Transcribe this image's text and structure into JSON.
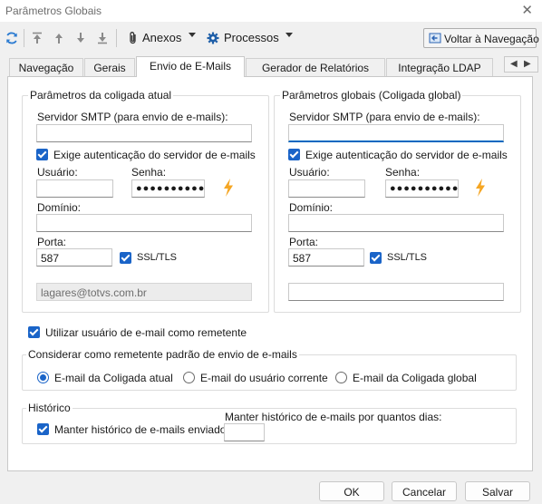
{
  "window": {
    "title": "Parâmetros Globais"
  },
  "toolbar": {
    "anexos_label": "Anexos",
    "processos_label": "Processos",
    "voltar_label": "Voltar à Navegação"
  },
  "tabs": [
    {
      "label": "Navegação"
    },
    {
      "label": "Gerais"
    },
    {
      "label": "Envio de E-Mails",
      "active": true
    },
    {
      "label": "Gerador de Relatórios"
    },
    {
      "label": "Integração LDAP"
    }
  ],
  "coligada_atual": {
    "legend": "Parâmetros da coligada atual",
    "smtp_label": "Servidor SMTP (para envio de e-mails):",
    "smtp_value": "",
    "auth_label": "Exige autenticação do servidor de e-mails",
    "auth_checked": true,
    "usuario_label": "Usuário:",
    "usuario_value": "",
    "senha_label": "Senha:",
    "senha_value": "●●●●●●●●●●●",
    "dominio_label": "Domínio:",
    "dominio_value": "",
    "porta_label": "Porta:",
    "porta_value": "587",
    "ssl_label": "SSL/TLS",
    "ssl_checked": true,
    "email_value": "lagares@totvs.com.br"
  },
  "coligada_global": {
    "legend": "Parâmetros globais (Coligada global)",
    "smtp_label": "Servidor SMTP (para envio de e-mails):",
    "smtp_value": "",
    "auth_label": "Exige autenticação do servidor de e-mails",
    "auth_checked": true,
    "usuario_label": "Usuário:",
    "usuario_value": "",
    "senha_label": "Senha:",
    "senha_value": "●●●●●●●●●●●",
    "dominio_label": "Domínio:",
    "dominio_value": "",
    "porta_label": "Porta:",
    "porta_value": "587",
    "ssl_label": "SSL/TLS",
    "ssl_checked": true,
    "email_value": ""
  },
  "utilizar_remetente_label": "Utilizar usuário de e-mail como remetente",
  "remetente_padrao": {
    "legend": "Considerar como remetente padrão de envio de e-mails",
    "options": [
      "E-mail da Coligada atual",
      "E-mail do usuário corrente",
      "E-mail da Coligada global"
    ],
    "selected": "E-mail da Coligada atual"
  },
  "historico": {
    "legend": "Histórico",
    "manter_label": "Manter histórico de e-mails enviados",
    "manter_checked": true,
    "dias_label": "Manter histórico de e-mails por quantos dias:",
    "dias_value": ""
  },
  "buttons": {
    "ok": "OK",
    "cancelar": "Cancelar",
    "salvar": "Salvar"
  },
  "colors": {
    "accent": "#1a64c8",
    "bolt": "#f5a623"
  }
}
